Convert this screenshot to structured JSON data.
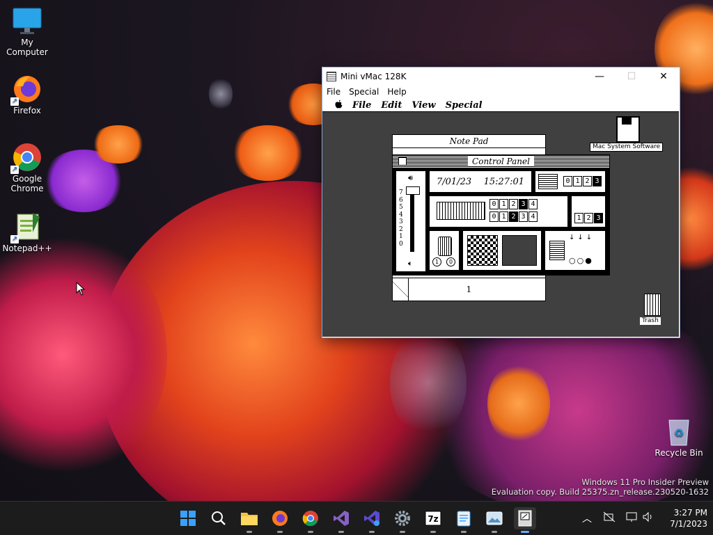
{
  "desktop": {
    "icons": [
      {
        "label": "My Computer",
        "icon": "monitor-icon"
      },
      {
        "label": "Firefox",
        "icon": "firefox-icon"
      },
      {
        "label": "Google Chrome",
        "icon": "chrome-icon"
      },
      {
        "label": "Notepad++",
        "icon": "notepadpp-icon"
      },
      {
        "label": "Recycle Bin",
        "icon": "recycle-bin-icon"
      }
    ],
    "watermark": {
      "line1": "Windows 11 Pro Insider Preview",
      "line2": "Evaluation copy. Build 25375.zn_release.230520-1632"
    }
  },
  "window": {
    "title": "Mini vMac 128K",
    "menu": [
      "File",
      "Special",
      "Help"
    ],
    "controls": {
      "minimize": "—",
      "maximize": "☐",
      "close": "✕"
    }
  },
  "mac": {
    "menu": [
      "File",
      "Edit",
      "View",
      "Special"
    ],
    "apple": "",
    "notepad": {
      "title": "Note Pad",
      "page": "1"
    },
    "control_panel": {
      "title": "Control Panel",
      "date": "7/01/23",
      "time": "15:27:01",
      "volume_ticks": [
        "7",
        "6",
        "5",
        "4",
        "3",
        "2",
        "1",
        "0"
      ],
      "digits_a": [
        "0",
        "1",
        "2",
        "3"
      ],
      "digits_b": [
        "0",
        "1",
        "2",
        "3",
        "4"
      ],
      "digits_c": [
        "0",
        "1",
        "2",
        "3",
        "4"
      ],
      "digits_d": [
        "1",
        "2",
        "3"
      ],
      "mouse_labels": [
        "1",
        "0"
      ]
    },
    "disk_label": "Mac System Software",
    "trash_label": "Trash"
  },
  "taskbar": {
    "apps": [
      "start-icon",
      "search-icon",
      "file-explorer-icon",
      "firefox-icon",
      "chrome-icon",
      "visual-studio-icon",
      "visual-studio-preview-icon",
      "settings-icon",
      "7zip-icon",
      "notepad-icon",
      "photos-icon",
      "mini-vmac-icon"
    ],
    "time": "3:27 PM",
    "date": "7/1/2023"
  },
  "colors": {
    "accent": "#6aa9ff",
    "taskbar": "#1c1c1c"
  }
}
